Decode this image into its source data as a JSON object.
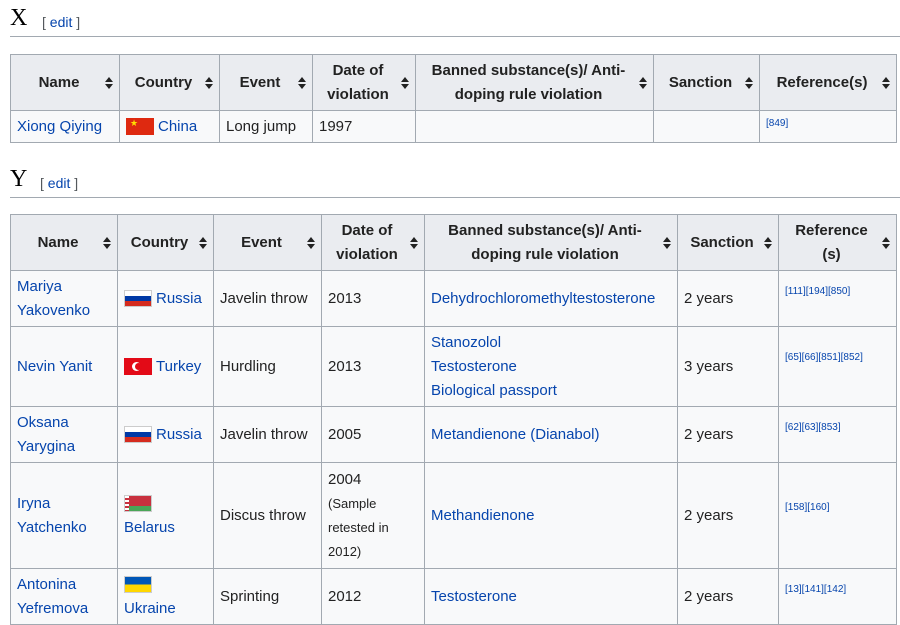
{
  "sections": [
    {
      "letter": "X",
      "edit_label": "edit",
      "headers": [
        "Name",
        "Country",
        "Event",
        "Date of violation",
        "Banned substance(s)/ Anti-doping rule violation",
        "Sanction",
        "Reference(s)"
      ],
      "rows": [
        {
          "name": "Xiong Qiying",
          "country": "China",
          "flag": "china-flag",
          "event": "Long jump",
          "date": "1997",
          "substances": [],
          "sanction": "",
          "refs": "[849]"
        }
      ]
    },
    {
      "letter": "Y",
      "edit_label": "edit",
      "headers": [
        "Name",
        "Country",
        "Event",
        "Date of violation",
        "Banned substance(s)/ Anti-doping rule violation",
        "Sanction",
        "Reference (s)"
      ],
      "rows": [
        {
          "name": "Mariya Yakovenko",
          "country": "Russia",
          "flag": "russia-flag",
          "event": "Javelin throw",
          "date": "2013",
          "date_note": "",
          "substances": [
            "Dehydrochloromethyltestosterone"
          ],
          "sanction": "2 years",
          "refs": "[111][194][850]"
        },
        {
          "name": "Nevin Yanit",
          "country": "Turkey",
          "flag": "turkey-flag",
          "event": "Hurdling",
          "date": "2013",
          "date_note": "",
          "substances": [
            "Stanozolol",
            "Testosterone",
            "Biological passport"
          ],
          "sanction": "3 years",
          "refs": "[65][66][851][852]"
        },
        {
          "name": "Oksana Yarygina",
          "country": "Russia",
          "flag": "russia-flag",
          "event": "Javelin throw",
          "date": "2005",
          "date_note": "",
          "substances": [
            "Metandienone (Dianabol)"
          ],
          "sanction": "2 years",
          "refs": "[62][63][853]"
        },
        {
          "name": "Iryna Yatchenko",
          "country": "Belarus",
          "flag": "belarus-flag",
          "event": "Discus throw",
          "date": "2004",
          "date_note": "(Sample retested in 2012)",
          "substances": [
            "Methandienone"
          ],
          "sanction": "2 years",
          "refs": "[158][160]"
        },
        {
          "name": "Antonina Yefremova",
          "country": "Ukraine",
          "flag": "ukraine-flag",
          "event": "Sprinting",
          "date": "2012",
          "date_note": "",
          "substances": [
            "Testosterone"
          ],
          "sanction": "2 years",
          "refs": "[13][141][142]"
        }
      ]
    }
  ]
}
